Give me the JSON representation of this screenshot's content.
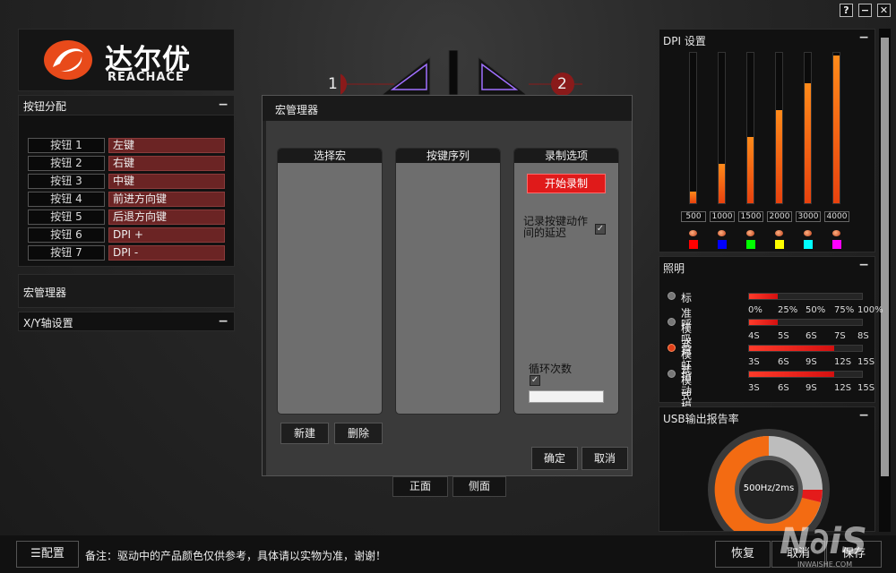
{
  "window": {
    "help": "?",
    "minimize": "−",
    "close": "✕"
  },
  "logo": {
    "cn": "达尔优",
    "en": "REACHACE"
  },
  "mouse": {
    "markers": [
      "1",
      "2"
    ]
  },
  "button_assign": {
    "title": "按钮分配",
    "rows": [
      {
        "name": "按钮 1",
        "func": "左键"
      },
      {
        "name": "按钮 2",
        "func": "右键"
      },
      {
        "name": "按钮 3",
        "func": "中键"
      },
      {
        "name": "按钮 4",
        "func": "前进方向键"
      },
      {
        "name": "按钮 5",
        "func": "后退方向键"
      },
      {
        "name": "按钮 6",
        "func": "DPI +"
      },
      {
        "name": "按钮 7",
        "func": "DPI -"
      }
    ]
  },
  "macro_manager_section": {
    "title": "宏管理器"
  },
  "xy_section": {
    "title": "X/Y轴设置"
  },
  "macro_dialog": {
    "title": "宏管理器",
    "col_select": "选择宏",
    "col_sequence": "按键序列",
    "col_options": "录制选项",
    "record_button": "开始录制",
    "record_delay_label": "记录按键动作间的延迟",
    "loop_label": "循环次数",
    "loop_value": "",
    "new_button": "新建",
    "delete_button": "删除",
    "ok_button": "确定",
    "cancel_button": "取消"
  },
  "view_tabs": {
    "front": "正面",
    "side": "侧面"
  },
  "dpi": {
    "title": "DPI 设置",
    "levels": [
      {
        "label": "500",
        "fill": 0.08,
        "color": "#ff0000"
      },
      {
        "label": "1000",
        "fill": 0.26,
        "color": "#0000ff"
      },
      {
        "label": "1500",
        "fill": 0.44,
        "color": "#00ff00"
      },
      {
        "label": "2000",
        "fill": 0.62,
        "color": "#ffff00"
      },
      {
        "label": "3000",
        "fill": 0.8,
        "color": "#00ffff"
      },
      {
        "label": "4000",
        "fill": 0.98,
        "color": "#ff00ff"
      }
    ]
  },
  "lighting": {
    "title": "照明",
    "modes": [
      {
        "label": "标准模式",
        "fill": 0.25,
        "ticks": [
          "0%",
          "25%",
          "50%",
          "75%",
          "100%"
        ],
        "selected": false
      },
      {
        "label": "呼吸模式",
        "fill": 0.25,
        "ticks": [
          "4S",
          "5S",
          "6S",
          "7S",
          "8S"
        ],
        "selected": false
      },
      {
        "label": "霓虹模式",
        "fill": 0.75,
        "ticks": [
          "3S",
          "6S",
          "9S",
          "12S",
          "15S"
        ],
        "selected": true
      },
      {
        "label": "指动模式",
        "fill": 0.75,
        "ticks": [
          "3S",
          "6S",
          "9S",
          "12S",
          "15S"
        ],
        "selected": false
      }
    ]
  },
  "usb": {
    "title": "USB输出报告率",
    "rate": "500Hz/2ms"
  },
  "bottom": {
    "config_button": "配置",
    "note": "备注：驱动中的产品颜色仅供参考，具体请以实物为准，谢谢！",
    "restore_button": "恢复",
    "cancel_button": "取消",
    "save_button": "保存"
  },
  "watermark": {
    "text": "INWAISHE.COM"
  }
}
